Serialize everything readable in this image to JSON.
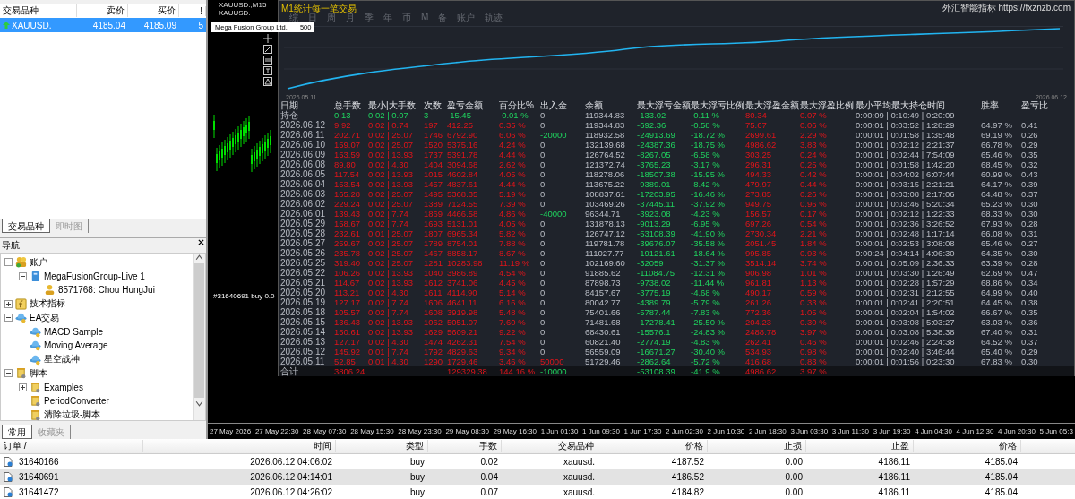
{
  "market_watch": {
    "columns": [
      "交易品种",
      "卖价",
      "买价",
      "!"
    ],
    "rows": [
      {
        "symbol": "XAUUSD.",
        "bid": "4185.04",
        "ask": "4185.09",
        "spread": "5",
        "selected": true
      }
    ],
    "tabs": [
      {
        "label": "交易品种",
        "selected": true
      },
      {
        "label": "即时图",
        "selected": false
      }
    ]
  },
  "navigator": {
    "title": "导航",
    "tree": [
      {
        "label": "账户",
        "kind": "accounts",
        "expanded": true,
        "children": [
          {
            "label": "MegaFusionGroup-Live 1",
            "kind": "server",
            "expanded": true,
            "children": [
              {
                "label": "8571768: Chou HungJui",
                "kind": "account"
              }
            ]
          }
        ]
      },
      {
        "label": "技术指标",
        "kind": "indicators",
        "expanded": false
      },
      {
        "label": "EA交易",
        "kind": "experts",
        "expanded": true,
        "children": [
          {
            "label": "MACD Sample",
            "kind": "expert"
          },
          {
            "label": "Moving Average",
            "kind": "expert"
          },
          {
            "label": "星空战神",
            "kind": "expert"
          }
        ]
      },
      {
        "label": "脚本",
        "kind": "scripts",
        "expanded": true,
        "children": [
          {
            "label": "Examples",
            "kind": "script",
            "expanded": false
          },
          {
            "label": "PeriodConverter",
            "kind": "script"
          },
          {
            "label": "清除垃圾-脚本",
            "kind": "script"
          }
        ]
      }
    ],
    "tabs": [
      {
        "label": "常用",
        "selected": true
      },
      {
        "label": "收藏夹",
        "selected": false
      }
    ]
  },
  "chart": {
    "symbol_period": "XAUUSD.,M15",
    "symbol": "XAUUSD.",
    "broker": "Mega Fusion Group Ltd.",
    "leverage": "500",
    "trade_label": "#31640691 buy 0.0",
    "time_axis": [
      "27 May 2026",
      "27 May 22:30",
      "28 May 07:30",
      "28 May 15:30",
      "28 May 23:30",
      "29 May 08:30",
      "29 May 16:30",
      "1 Jun 01:30",
      "1 Jun 09:30",
      "1 Jun 17:30",
      "2 Jun 02:30",
      "2 Jun 10:30",
      "2 Jun 18:30",
      "3 Jun 03:30",
      "3 Jun 11:30",
      "3 Jun 19:30",
      "4 Jun 04:30",
      "4 Jun 12:30",
      "4 Jun 20:30",
      "5 Jun 05:3"
    ]
  },
  "stats": {
    "title": "M1统计每一笔交易",
    "tabs": [
      "综",
      "日",
      "周",
      "月",
      "季",
      "年",
      "币",
      "M",
      "备",
      "账户",
      "轨迹"
    ],
    "site": "外汇智能指标 https://fxznzb.com",
    "start_date": "2026.05.11",
    "end_date": "2026.06.12",
    "columns": [
      "日期",
      "总手数",
      "最小|大手数",
      "次数",
      "盈亏金额",
      "百分比%",
      "出入金",
      "余额",
      "最大浮亏金额",
      "最大浮亏比例",
      "最大浮盈金额",
      "最大浮盈比例",
      "最小平均最大持仓时间",
      "胜率",
      "盈亏比"
    ],
    "rows": [
      {
        "kind": "open",
        "withdrawal": false,
        "deposit": false,
        "cells": [
          "持仓",
          "0.13",
          "0.02 | 0.07",
          "3",
          "-15.45",
          "-0.01 %",
          "0",
          "119344.83",
          "-133.02",
          "-0.11 %",
          "80.34",
          "0.07 %",
          "0:00:09 | 0:10:49 | 0:20:09",
          null,
          null
        ]
      },
      {
        "kind": "day",
        "withdrawal": false,
        "deposit": false,
        "cells": [
          "2026.06.12",
          "9.92",
          "0.02 | 0.74",
          "197",
          "412.25",
          "0.35 %",
          "0",
          "119344.83",
          "-692.36",
          "-0.58 %",
          "75.67",
          "0.06 %",
          "0:00:01 | 0:03:52 | 1:28:29",
          "64.97 %",
          "0.41"
        ]
      },
      {
        "kind": "day",
        "withdrawal": true,
        "deposit": false,
        "cells": [
          "2026.06.11",
          "202.71",
          "0.02 | 25.07",
          "1746",
          "6792.90",
          "6.06 %",
          "-20000",
          "118932.58",
          "-24913.69",
          "-18.72 %",
          "2699.61",
          "2.29 %",
          "0:00:01 | 0:01:58 | 1:35:48",
          "69.19 %",
          "0.26"
        ]
      },
      {
        "kind": "day",
        "withdrawal": false,
        "deposit": false,
        "cells": [
          "2026.06.10",
          "159.07",
          "0.02 | 25.07",
          "1520",
          "5375.16",
          "4.24 %",
          "0",
          "132139.68",
          "-24387.36",
          "-18.75 %",
          "4986.62",
          "3.83 %",
          "0:00:01 | 0:02:12 | 2:21:37",
          "66.78 %",
          "0.29"
        ]
      },
      {
        "kind": "day",
        "withdrawal": false,
        "deposit": false,
        "cells": [
          "2026.06.09",
          "153.59",
          "0.02 | 13.93",
          "1737",
          "5391.78",
          "4.44 %",
          "0",
          "126764.52",
          "-8267.05",
          "-6.58 %",
          "303.25",
          "0.24 %",
          "0:00:01 | 0:02:44 | 7:54:09",
          "65.46 %",
          "0.35"
        ]
      },
      {
        "kind": "day",
        "withdrawal": false,
        "deposit": false,
        "cells": [
          "2026.06.08",
          "89.80",
          "0.02 | 4.30",
          "1404",
          "3094.68",
          "2.62 %",
          "0",
          "121372.74",
          "-3765.23",
          "-3.17 %",
          "296.31",
          "0.25 %",
          "0:00:01 | 0:01:58 | 1:42:20",
          "68.45 %",
          "0.32"
        ]
      },
      {
        "kind": "day",
        "withdrawal": false,
        "deposit": false,
        "cells": [
          "2026.06.05",
          "117.54",
          "0.02 | 13.93",
          "1015",
          "4602.84",
          "4.05 %",
          "0",
          "118278.06",
          "-18507.38",
          "-15.95 %",
          "494.33",
          "0.42 %",
          "0:00:01 | 0:04:02 | 6:07:44",
          "60.99 %",
          "0.43"
        ]
      },
      {
        "kind": "day",
        "withdrawal": false,
        "deposit": false,
        "cells": [
          "2026.06.04",
          "153.54",
          "0.02 | 13.93",
          "1457",
          "4837.61",
          "4.44 %",
          "0",
          "113675.22",
          "-9389.01",
          "-8.42 %",
          "479.97",
          "0.44 %",
          "0:00:01 | 0:03:15 | 2:21:21",
          "64.17 %",
          "0.39"
        ]
      },
      {
        "kind": "day",
        "withdrawal": false,
        "deposit": false,
        "cells": [
          "2026.06.03",
          "165.28",
          "0.02 | 25.07",
          "1495",
          "5368.35",
          "5.19 %",
          "0",
          "108837.61",
          "-17203.95",
          "-16.46 %",
          "273.85",
          "0.26 %",
          "0:00:01 | 0:03:08 | 2:17:06",
          "64.48 %",
          "0.37"
        ]
      },
      {
        "kind": "day",
        "withdrawal": false,
        "deposit": false,
        "cells": [
          "2026.06.02",
          "229.24",
          "0.02 | 25.07",
          "1389",
          "7124.55",
          "7.39 %",
          "0",
          "103469.26",
          "-37445.11",
          "-37.92 %",
          "949.75",
          "0.96 %",
          "0:00:01 | 0:03:46 | 5:20:34",
          "65.23 %",
          "0.30"
        ]
      },
      {
        "kind": "day",
        "withdrawal": true,
        "deposit": false,
        "cells": [
          "2026.06.01",
          "139.43",
          "0.02 | 7.74",
          "1869",
          "4466.58",
          "4.86 %",
          "-40000",
          "96344.71",
          "-3923.08",
          "-4.23 %",
          "156.57",
          "0.17 %",
          "0:00:01 | 0:02:12 | 1:22:33",
          "68.33 %",
          "0.30"
        ]
      },
      {
        "kind": "day",
        "withdrawal": false,
        "deposit": false,
        "cells": [
          "2026.05.29",
          "158.67",
          "0.02 | 7.74",
          "1693",
          "5131.01",
          "4.05 %",
          "0",
          "131878.13",
          "-9013.29",
          "-6.95 %",
          "697.26",
          "0.54 %",
          "0:00:01 | 0:02:36 | 3:26:52",
          "67.93 %",
          "0.28"
        ]
      },
      {
        "kind": "day",
        "withdrawal": false,
        "deposit": false,
        "cells": [
          "2026.05.28",
          "232.61",
          "0.01 | 25.07",
          "1807",
          "6965.34",
          "5.82 %",
          "0",
          "126747.12",
          "-53108.39",
          "-41.90 %",
          "2730.34",
          "2.21 %",
          "0:00:01 | 0:02:48 | 1:17:14",
          "66.08 %",
          "0.31"
        ]
      },
      {
        "kind": "day",
        "withdrawal": false,
        "deposit": false,
        "cells": [
          "2026.05.27",
          "259.67",
          "0.02 | 25.07",
          "1789",
          "8754.01",
          "7.88 %",
          "0",
          "119781.78",
          "-39676.07",
          "-35.58 %",
          "2051.45",
          "1.84 %",
          "0:00:01 | 0:02:53 | 3:08:08",
          "65.46 %",
          "0.27"
        ]
      },
      {
        "kind": "day",
        "withdrawal": false,
        "deposit": false,
        "cells": [
          "2026.05.26",
          "235.78",
          "0.02 | 25.07",
          "1467",
          "8858.17",
          "8.67 %",
          "0",
          "111027.77",
          "-19121.61",
          "-18.64 %",
          "995.85",
          "0.93 %",
          "0:00:24 | 0:04:14 | 4:06:30",
          "64.35 %",
          "0.30"
        ]
      },
      {
        "kind": "day",
        "withdrawal": false,
        "deposit": false,
        "cells": [
          "2026.05.25",
          "319.40",
          "0.02 | 25.07",
          "1281",
          "10283.98",
          "11.19 %",
          "0",
          "102169.60",
          "-32059",
          "-31.37 %",
          "3514.14",
          "3.74 %",
          "0:00:01 | 0:05:09 | 2:36:33",
          "63.39 %",
          "0.28"
        ]
      },
      {
        "kind": "day",
        "withdrawal": false,
        "deposit": false,
        "cells": [
          "2026.05.22",
          "106.26",
          "0.02 | 13.93",
          "1040",
          "3986.89",
          "4.54 %",
          "0",
          "91885.62",
          "-11084.75",
          "-12.31 %",
          "906.98",
          "1.01 %",
          "0:00:01 | 0:03:30 | 1:26:49",
          "62.69 %",
          "0.47"
        ]
      },
      {
        "kind": "day",
        "withdrawal": false,
        "deposit": false,
        "cells": [
          "2026.05.21",
          "114.67",
          "0.02 | 13.93",
          "1612",
          "3741.06",
          "4.45 %",
          "0",
          "87898.73",
          "-9738.02",
          "-11.44 %",
          "961.81",
          "1.13 %",
          "0:00:01 | 0:02:28 | 1:57:29",
          "68.86 %",
          "0.34"
        ]
      },
      {
        "kind": "day",
        "withdrawal": false,
        "deposit": false,
        "cells": [
          "2026.05.20",
          "113.21",
          "0.02 | 4.30",
          "1611",
          "4114.90",
          "5.14 %",
          "0",
          "84157.67",
          "-3775.19",
          "-4.68 %",
          "490.17",
          "0.59 %",
          "0:00:01 | 0:02:31 | 2:12:55",
          "64.99 %",
          "0.40"
        ]
      },
      {
        "kind": "day",
        "withdrawal": false,
        "deposit": false,
        "cells": [
          "2026.05.19",
          "127.17",
          "0.02 | 7.74",
          "1606",
          "4641.11",
          "6.16 %",
          "0",
          "80042.77",
          "-4389.79",
          "-5.79 %",
          "261.26",
          "0.33 %",
          "0:00:01 | 0:02:41 | 2:20:51",
          "64.45 %",
          "0.38"
        ]
      },
      {
        "kind": "day",
        "withdrawal": false,
        "deposit": false,
        "cells": [
          "2026.05.18",
          "105.57",
          "0.02 | 7.74",
          "1608",
          "3919.98",
          "5.48 %",
          "0",
          "75401.66",
          "-5787.44",
          "-7.83 %",
          "772.36",
          "1.05 %",
          "0:00:01 | 0:02:04 | 1:54:02",
          "66.67 %",
          "0.35"
        ]
      },
      {
        "kind": "day",
        "withdrawal": false,
        "deposit": false,
        "cells": [
          "2026.05.15",
          "136.43",
          "0.02 | 13.93",
          "1062",
          "5051.07",
          "7.60 %",
          "0",
          "71481.68",
          "-17278.41",
          "-25.50 %",
          "204.23",
          "0.30 %",
          "0:00:01 | 0:03:08 | 5:03:27",
          "63.03 %",
          "0.36"
        ]
      },
      {
        "kind": "day",
        "withdrawal": false,
        "deposit": false,
        "cells": [
          "2026.05.14",
          "150.61",
          "0.02 | 13.93",
          "1629",
          "5609.21",
          "9.22 %",
          "0",
          "68430.61",
          "-15576.1",
          "-24.83 %",
          "2488.78",
          "3.97 %",
          "0:00:01 | 0:03:08 | 5:38:38",
          "67.40 %",
          "0.31"
        ]
      },
      {
        "kind": "day",
        "withdrawal": false,
        "deposit": false,
        "cells": [
          "2026.05.13",
          "127.17",
          "0.02 | 4.30",
          "1474",
          "4262.31",
          "7.54 %",
          "0",
          "60821.40",
          "-2774.19",
          "-4.83 %",
          "262.41",
          "0.46 %",
          "0:00:01 | 0:02:46 | 2:24:38",
          "64.52 %",
          "0.37"
        ]
      },
      {
        "kind": "day",
        "withdrawal": false,
        "deposit": false,
        "cells": [
          "2026.05.12",
          "145.92",
          "0.01 | 7.74",
          "1792",
          "4829.63",
          "9.34 %",
          "0",
          "56559.09",
          "-16671.27",
          "-30.40 %",
          "534.93",
          "0.98 %",
          "0:00:01 | 0:02:40 | 3:46:44",
          "65.40 %",
          "0.29"
        ]
      },
      {
        "kind": "day",
        "withdrawal": false,
        "deposit": true,
        "cells": [
          "2026.05.11",
          "52.85",
          "0.01 | 4.30",
          "1290",
          "1729.46",
          "3.46 %",
          "50000",
          "51729.46",
          "-2862.64",
          "-5.72 %",
          "416.68",
          "0.83 %",
          "0:00:01 | 0:01:56 | 0:23:30",
          "67.83 %",
          "0.30"
        ]
      },
      {
        "kind": "total",
        "withdrawal": true,
        "deposit": false,
        "cells": [
          "合计",
          "3806.24",
          null,
          null,
          "129329.38",
          "144.16 %",
          "-10000",
          null,
          "-53108.39",
          "-41.9 %",
          "4986.62",
          "3.97 %",
          null,
          null,
          null
        ]
      }
    ]
  },
  "orders": {
    "columns": [
      "订单 /",
      "时间",
      "类型",
      "手数",
      "交易品种",
      "价格",
      "止损",
      "止盈",
      "价格"
    ],
    "rows": [
      [
        "31640166",
        "2026.06.12 04:06:02",
        "buy",
        "0.02",
        "xauusd.",
        "4187.52",
        "0.00",
        "4186.11",
        "4185.04"
      ],
      [
        "31640691",
        "2026.06.12 04:14:01",
        "buy",
        "0.04",
        "xauusd.",
        "4186.52",
        "0.00",
        "4186.11",
        "4185.04"
      ],
      [
        "31641472",
        "2026.06.12 04:26:02",
        "buy",
        "0.07",
        "xauusd.",
        "4184.82",
        "0.00",
        "4186.11",
        "4185.04"
      ]
    ]
  }
}
